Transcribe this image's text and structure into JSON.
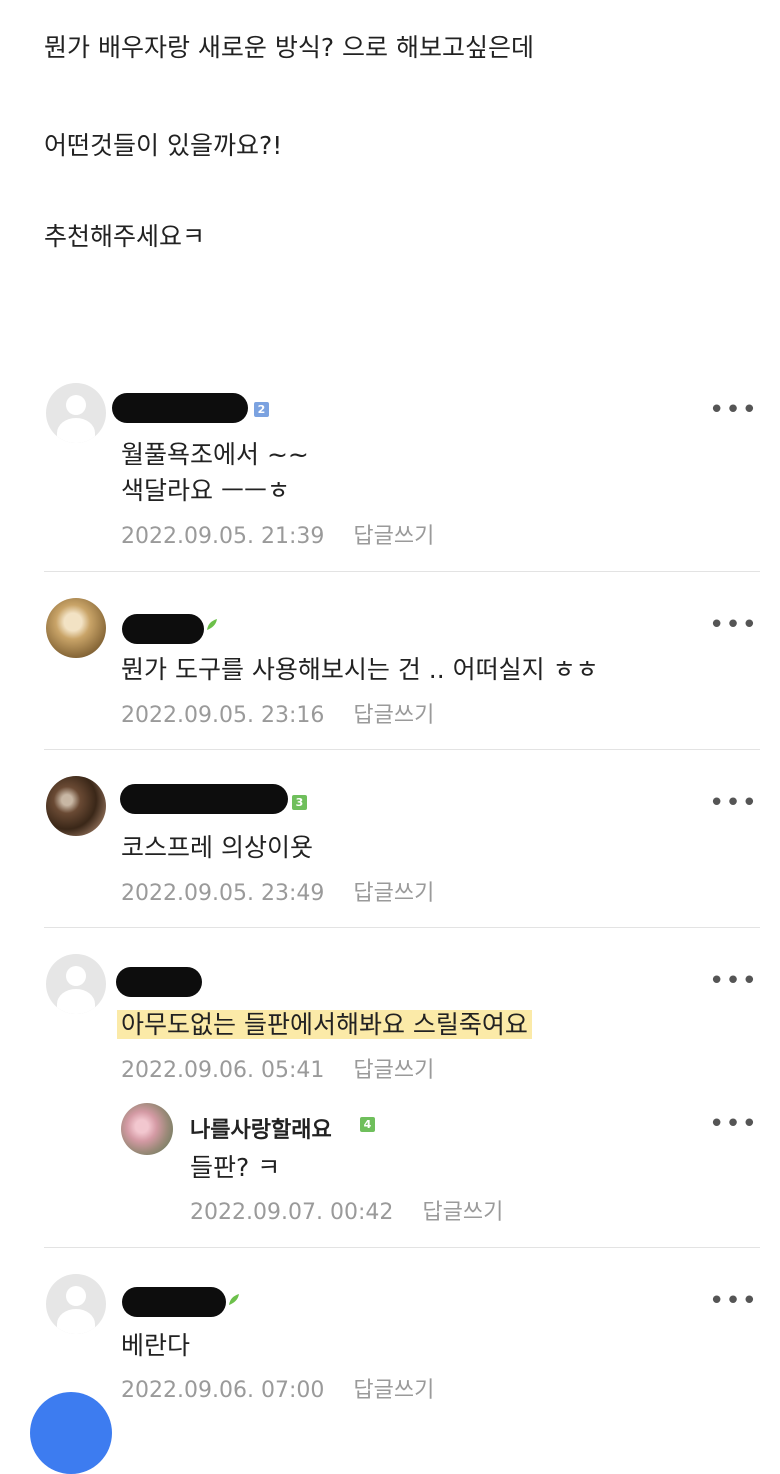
{
  "post": {
    "lines": [
      "뭔가 배우자랑 새로운 방식? 으로 해보고싶은데",
      "어떤것들이 있을까요?!",
      "추천해주세요ㅋ"
    ]
  },
  "comments": [
    {
      "level": "2",
      "level_color": "#7ba2e0",
      "text_lines": [
        "월풀욕조에서 ~~",
        "색달라요 ㅡㅡㅎ"
      ],
      "date": "2022.09.05. 21:39",
      "reply_label": "답글쓰기",
      "more_label": "•••"
    },
    {
      "badge_icon": "sprout-icon",
      "text": "뭔가 도구를 사용해보시는 건 .. 어떠실지 ㅎㅎ",
      "date": "2022.09.05. 23:16",
      "reply_label": "답글쓰기",
      "more_label": "•••"
    },
    {
      "level": "3",
      "level_color": "#6fbf5c",
      "text": "코스프레 의상이욧",
      "date": "2022.09.05. 23:49",
      "reply_label": "답글쓰기",
      "more_label": "•••"
    },
    {
      "text": "아무도없는 들판에서해봐요 스릴죽여요",
      "date": "2022.09.06. 05:41",
      "reply_label": "답글쓰기",
      "more_label": "•••",
      "reply": {
        "author": "나를사랑할래요",
        "level": "4",
        "level_color": "#6fbf5c",
        "text": "들판? ㅋ",
        "date": "2022.09.07. 00:42",
        "reply_label": "답글쓰기",
        "more_label": "•••"
      }
    },
    {
      "badge_icon": "sprout-icon",
      "text": "베란다",
      "date": "2022.09.06. 07:00",
      "reply_label": "답글쓰기",
      "more_label": "•••"
    }
  ]
}
